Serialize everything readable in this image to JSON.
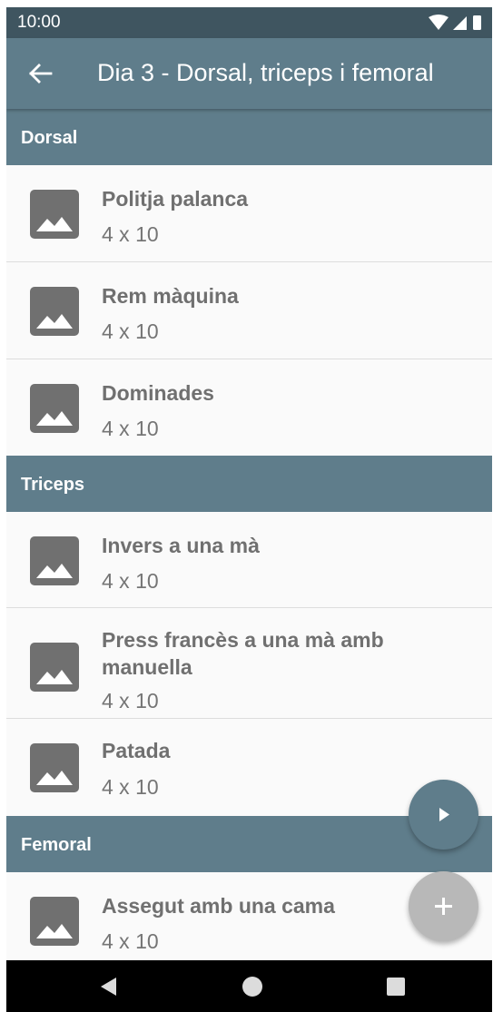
{
  "status_bar": {
    "time": "10:00",
    "icons": [
      "wifi-icon",
      "signal-icon",
      "battery-icon"
    ]
  },
  "app_bar": {
    "back_icon": "arrow-back-icon",
    "title": "Dia 3 - Dorsal, triceps i femoral"
  },
  "sections": [
    {
      "title": "Dorsal",
      "items": [
        {
          "name": "Politja palanca",
          "sets": "4 x 10"
        },
        {
          "name": "Rem màquina",
          "sets": "4 x 10"
        },
        {
          "name": "Dominades",
          "sets": "4 x 10"
        }
      ]
    },
    {
      "title": "Triceps",
      "items": [
        {
          "name": "Invers a una mà",
          "sets": "4 x 10"
        },
        {
          "name": "Press francès a una mà amb manuella",
          "sets": "4 x 10"
        },
        {
          "name": "Patada",
          "sets": "4 x 10"
        }
      ]
    },
    {
      "title": "Femoral",
      "items": [
        {
          "name": "Assegut amb una cama",
          "sets": "4 x 10"
        }
      ]
    }
  ],
  "fabs": {
    "play_icon": "play-icon",
    "add_icon": "add-icon"
  },
  "nav_bar": {
    "icons": [
      "nav-back-icon",
      "nav-home-icon",
      "nav-recents-icon"
    ]
  },
  "colors": {
    "primary": "#5f7d8b",
    "primary_dark": "#3f5560",
    "accent_fab": "#b8b8b8",
    "text_item": "#707070"
  }
}
